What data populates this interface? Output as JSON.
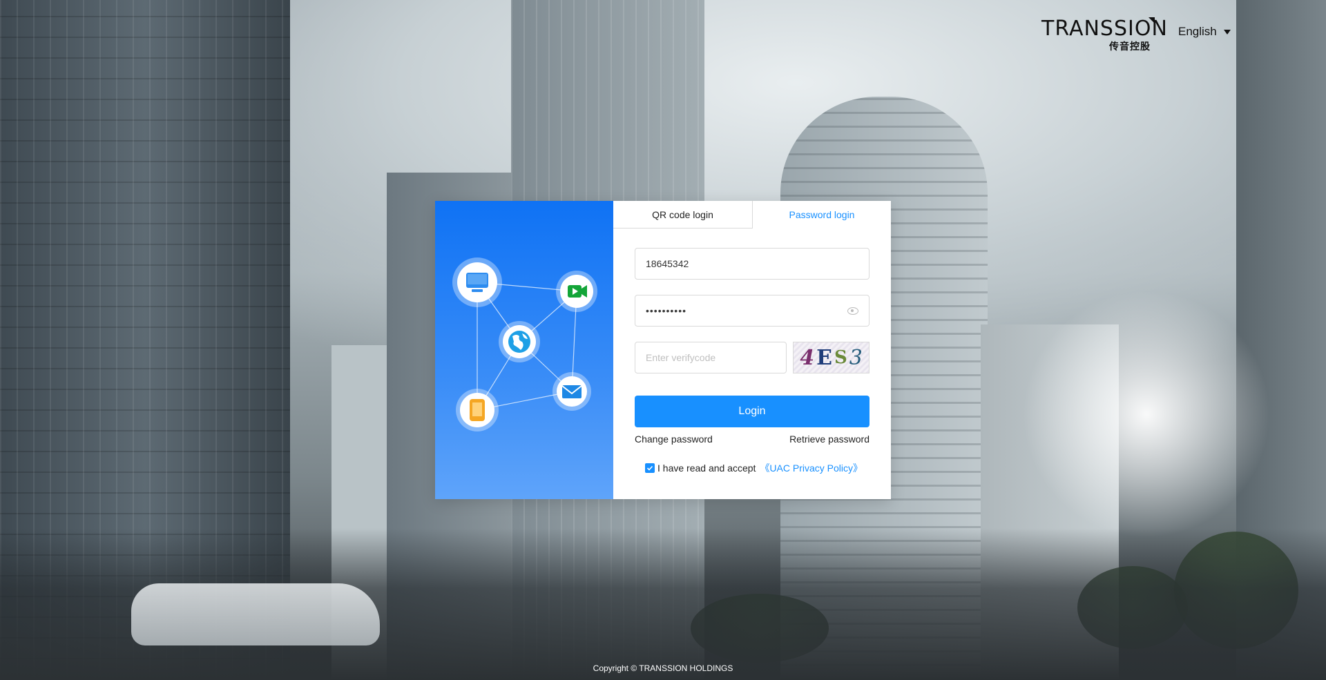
{
  "header": {
    "logo_text": "TRANSSION",
    "logo_subtext": "传音控股",
    "language": "English"
  },
  "tabs": [
    {
      "label": "QR code login",
      "active": false
    },
    {
      "label": "Password login",
      "active": true
    }
  ],
  "form": {
    "username_value": "18645342",
    "password_value": "••••••••••",
    "verifycode_placeholder": "Enter verifycode",
    "captcha_chars": [
      "4",
      "E",
      "S",
      "3"
    ],
    "login_label": "Login",
    "change_password": "Change password",
    "retrieve_password": "Retrieve password",
    "agree_checked": true,
    "agree_text": "I have read and accept",
    "policy_link": "《UAC Privacy Policy》"
  },
  "promo_icons": [
    "monitor-icon",
    "video-icon",
    "globe-icon",
    "mobile-icon",
    "mail-icon"
  ],
  "footer": {
    "copyright": "Copyright © TRANSSION HOLDINGS"
  },
  "colors": {
    "accent": "#1890ff",
    "promo_top": "#0f72f4",
    "promo_bottom": "#5fa4fa"
  }
}
